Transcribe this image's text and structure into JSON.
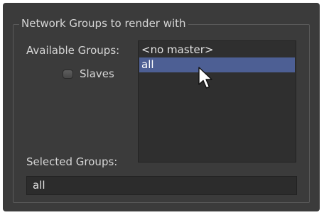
{
  "groupbox": {
    "title": "Network Groups to render with"
  },
  "available_groups": {
    "label": "Available Groups:",
    "items": [
      {
        "label": "<no master>",
        "selected": false
      },
      {
        "label": "all",
        "selected": true
      }
    ]
  },
  "slaves_checkbox": {
    "label": "Slaves",
    "checked": false
  },
  "selected_groups": {
    "label": "Selected Groups:",
    "value": "all"
  },
  "icons": {
    "cursor": "mouse-pointer-icon"
  }
}
